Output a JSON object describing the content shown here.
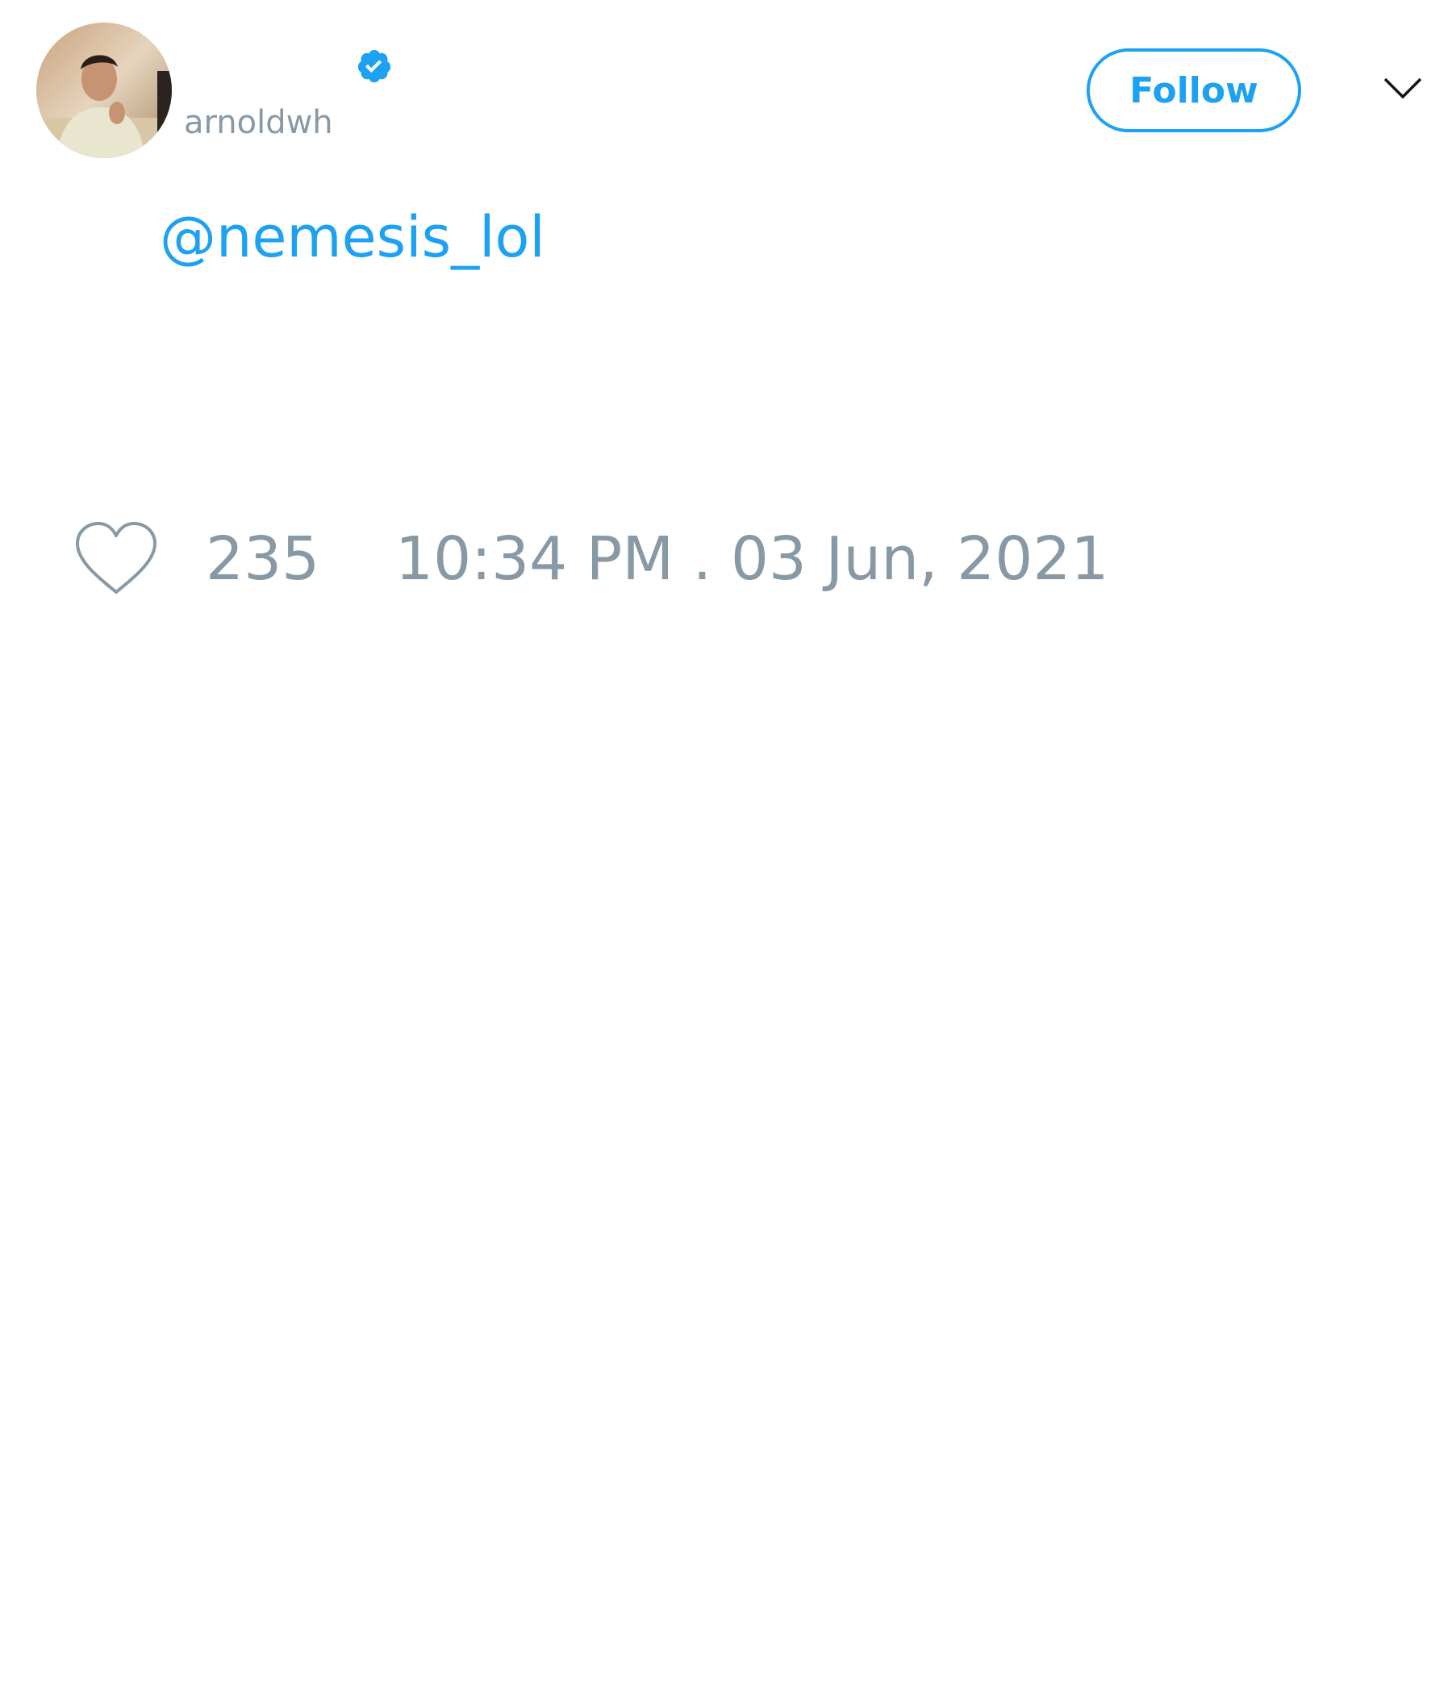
{
  "colors": {
    "accent": "#1da1f2",
    "muted": "#8899a6",
    "icon_dark": "#14171a",
    "background": "#ffffff"
  },
  "header": {
    "avatar_icon": "profile-photo",
    "verified_icon": "verified-badge-icon",
    "handle": "arnoldwh",
    "follow_label": "Follow",
    "menu_icon": "chevron-down-icon"
  },
  "tweet": {
    "text": "@nemesis_lol"
  },
  "footer": {
    "like_icon": "heart-icon",
    "like_count": "235",
    "timestamp": "10:34 PM . 03 Jun, 2021"
  }
}
